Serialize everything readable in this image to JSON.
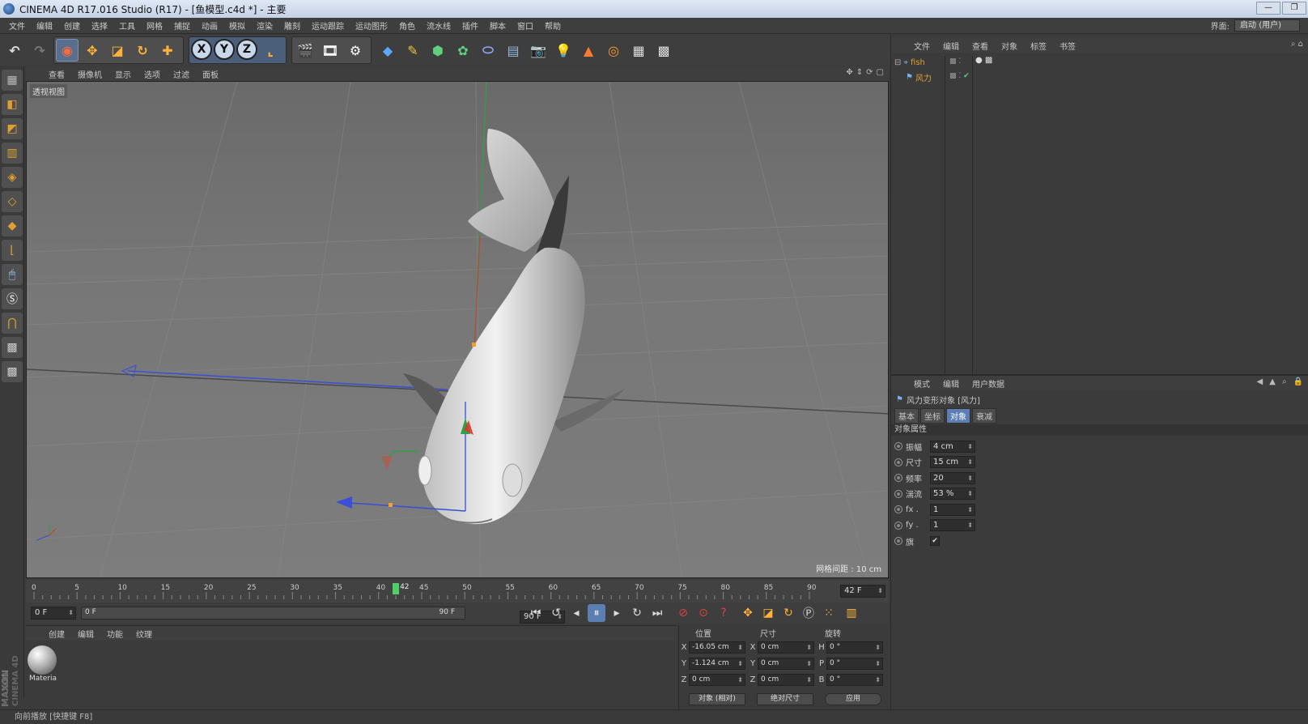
{
  "window": {
    "title": "CINEMA 4D R17.016 Studio (R17) - [鱼模型.c4d *] - 主要",
    "buttons": [
      "—",
      "❐"
    ]
  },
  "menubar": {
    "items": [
      "文件",
      "编辑",
      "创建",
      "选择",
      "工具",
      "网格",
      "捕捉",
      "动画",
      "模拟",
      "渲染",
      "雕刻",
      "运动跟踪",
      "运动图形",
      "角色",
      "流水线",
      "插件",
      "脚本",
      "窗口",
      "帮助"
    ],
    "layout_label": "界面:",
    "layout_value": "启动 (用户)"
  },
  "toolbar": {
    "axes": [
      "X",
      "Y",
      "Z"
    ]
  },
  "viewport": {
    "menu": [
      "查看",
      "摄像机",
      "显示",
      "选项",
      "过滤",
      "面板"
    ],
    "label": "透视视图",
    "grid_info": "网格间距 : 10 cm"
  },
  "timeline": {
    "ticks": [
      "0",
      "5",
      "10",
      "15",
      "20",
      "25",
      "30",
      "35",
      "40",
      "45",
      "50",
      "55",
      "60",
      "65",
      "70",
      "75",
      "80",
      "85",
      "90"
    ],
    "current_frame": "42",
    "end_display": "42 F"
  },
  "transport": {
    "start": "0 F",
    "range_start": "0 F",
    "range_end": "90 F",
    "end": "90 F"
  },
  "materials": {
    "menu": [
      "创建",
      "编辑",
      "功能",
      "纹理"
    ],
    "items": [
      {
        "name": "Materia"
      }
    ],
    "brand_top": "MAXON",
    "brand_bottom": "CINEMA 4D"
  },
  "coords": {
    "headers": [
      "位置",
      "尺寸",
      "旋转"
    ],
    "rows": [
      {
        "a": "X",
        "pos": "-16.05 cm",
        "b": "X",
        "size": "0 cm",
        "c": "H",
        "rot": "0 °"
      },
      {
        "a": "Y",
        "pos": "-1.124 cm",
        "b": "Y",
        "size": "0 cm",
        "c": "P",
        "rot": "0 °"
      },
      {
        "a": "Z",
        "pos": "0 cm",
        "b": "Z",
        "size": "0 cm",
        "c": "B",
        "rot": "0 °"
      }
    ],
    "mode": "对象 (相对)",
    "size_mode": "绝对尺寸",
    "apply": "应用"
  },
  "objects": {
    "menu": [
      "文件",
      "编辑",
      "查看",
      "对象",
      "标签",
      "书签"
    ],
    "items": [
      {
        "name": "fish"
      },
      {
        "name": "风力"
      }
    ]
  },
  "attributes": {
    "menu": [
      "模式",
      "编辑",
      "用户数据"
    ],
    "object_title": "风力变形对象 [风力]",
    "tabs": [
      "基本",
      "坐标",
      "对象",
      "衰减"
    ],
    "active_tab": "对象",
    "section": "对象属性",
    "params": [
      {
        "label": "振幅",
        "value": "4 cm"
      },
      {
        "label": "尺寸",
        "value": "15 cm"
      },
      {
        "label": "频率",
        "value": "20"
      },
      {
        "label": "湍流",
        "value": "53 %"
      },
      {
        "label": "fx .",
        "value": "1"
      },
      {
        "label": "fy .",
        "value": "1"
      },
      {
        "label": "旗",
        "value": "✔"
      }
    ]
  },
  "status": {
    "text": "向前播放 [快捷键 F8]"
  },
  "colors": {
    "accent": "#5b7fb3",
    "x_axis": "#3b4fd6",
    "y_axis": "#2ea04a",
    "z_axis": "#d43a2a"
  }
}
